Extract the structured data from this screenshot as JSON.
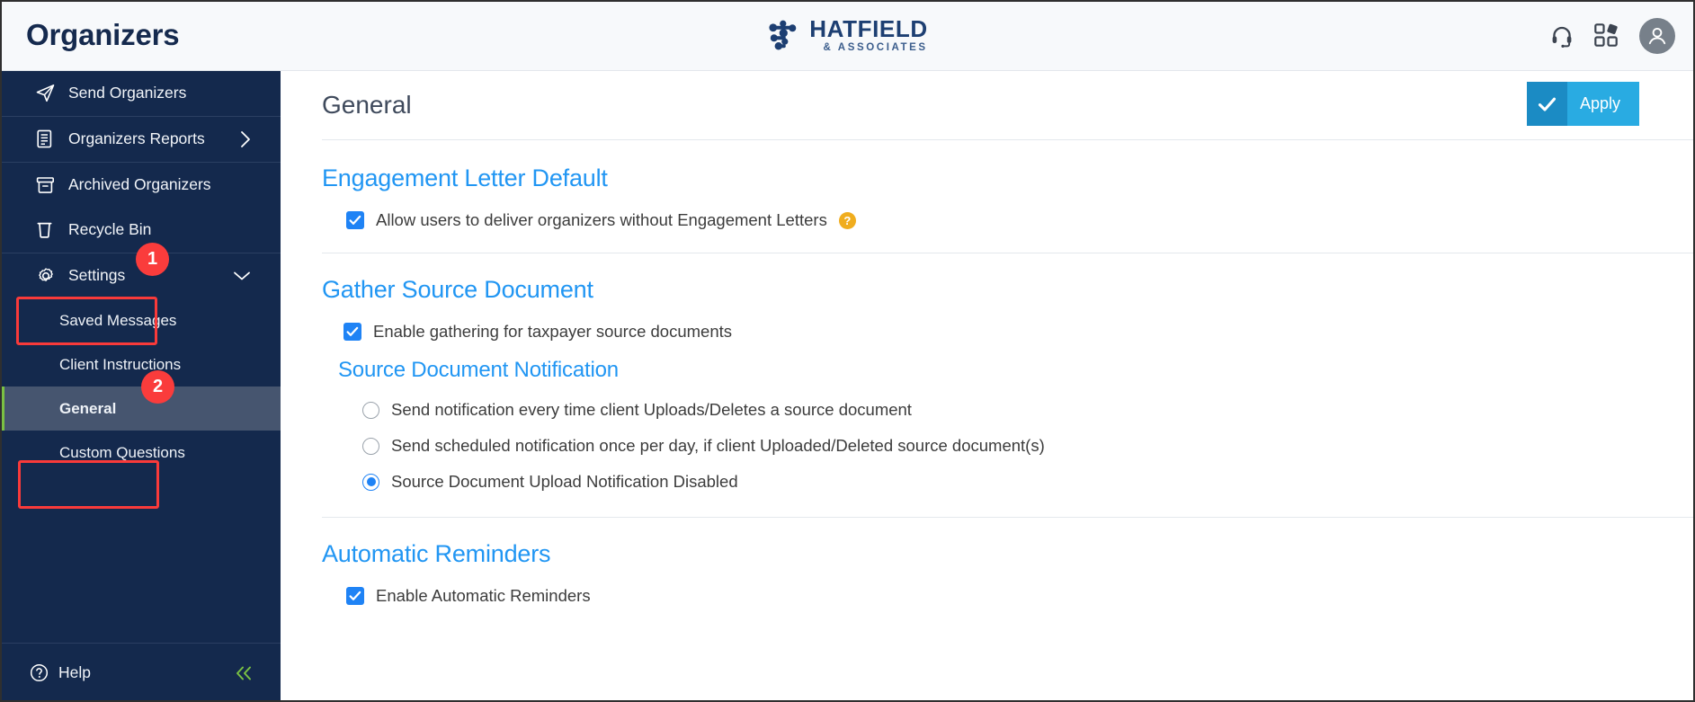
{
  "window": {
    "title": "Organizers"
  },
  "brand": {
    "name": "HATFIELD",
    "sub": "& ASSOCIATES",
    "mark_icon": "network-nodes-icon",
    "name_color": "#1d3f72"
  },
  "topbar": {
    "background": "#f7f9fb",
    "icons": [
      {
        "name": "headset-icon",
        "label": "Support"
      },
      {
        "name": "app-grid-icon",
        "label": "Apps"
      }
    ],
    "avatar": {
      "name": "user-avatar-icon",
      "color": "#77808a"
    }
  },
  "sidebar": {
    "background": "#14294d",
    "active_background": "#46556f",
    "accent": "#7ac143",
    "items": [
      {
        "label": "Send Organizers",
        "icon": "paper-plane-icon",
        "chevron": null
      },
      {
        "label": "Organizers Reports",
        "icon": "document-lines-icon",
        "chevron": "chevron-right-icon"
      },
      {
        "label": "Archived Organizers",
        "icon": "archive-box-icon",
        "chevron": null
      },
      {
        "label": "Recycle Bin",
        "icon": "trash-icon",
        "chevron": null
      },
      {
        "label": "Settings",
        "icon": "gear-icon",
        "chevron": "chevron-down-icon"
      }
    ],
    "subitems": [
      {
        "label": "Saved Messages",
        "active": false
      },
      {
        "label": "Client Instructions",
        "active": false
      },
      {
        "label": "General",
        "active": true
      },
      {
        "label": "Custom Questions",
        "active": false
      }
    ],
    "bottom": {
      "help_label": "Help",
      "help_icon": "question-circle-icon",
      "collapse_icon": "double-chevron-left-icon"
    }
  },
  "main": {
    "page_title": "General",
    "apply": {
      "label": "Apply",
      "icon": "check-icon",
      "color": "#29abe2",
      "icon_color": "#1b8bc4"
    },
    "heading_color": "#2196f3",
    "sections": [
      {
        "title": "Engagement Letter Default",
        "options": [
          {
            "type": "checkbox",
            "checked": true,
            "label": "Allow users to deliver organizers without Engagement Letters",
            "help": "?"
          }
        ]
      },
      {
        "title": "Gather Source Document",
        "options": [
          {
            "type": "checkbox",
            "checked": true,
            "label": "Enable gathering for taxpayer source documents"
          }
        ],
        "subsection": {
          "title": "Source Document Notification",
          "radios": [
            {
              "label": "Send notification every time client Uploads/Deletes a source document",
              "selected": false
            },
            {
              "label": "Send scheduled notification once per day, if client Uploaded/Deleted source document(s)",
              "selected": false
            },
            {
              "label": "Source Document Upload Notification Disabled",
              "selected": true
            }
          ]
        }
      },
      {
        "title": "Automatic Reminders",
        "options": [
          {
            "type": "checkbox",
            "checked": true,
            "label": "Enable Automatic Reminders"
          }
        ]
      }
    ]
  },
  "annotations": [
    {
      "number": "1",
      "target": "sidebar-item-settings"
    },
    {
      "number": "2",
      "target": "sidebar-subitem-general"
    }
  ]
}
